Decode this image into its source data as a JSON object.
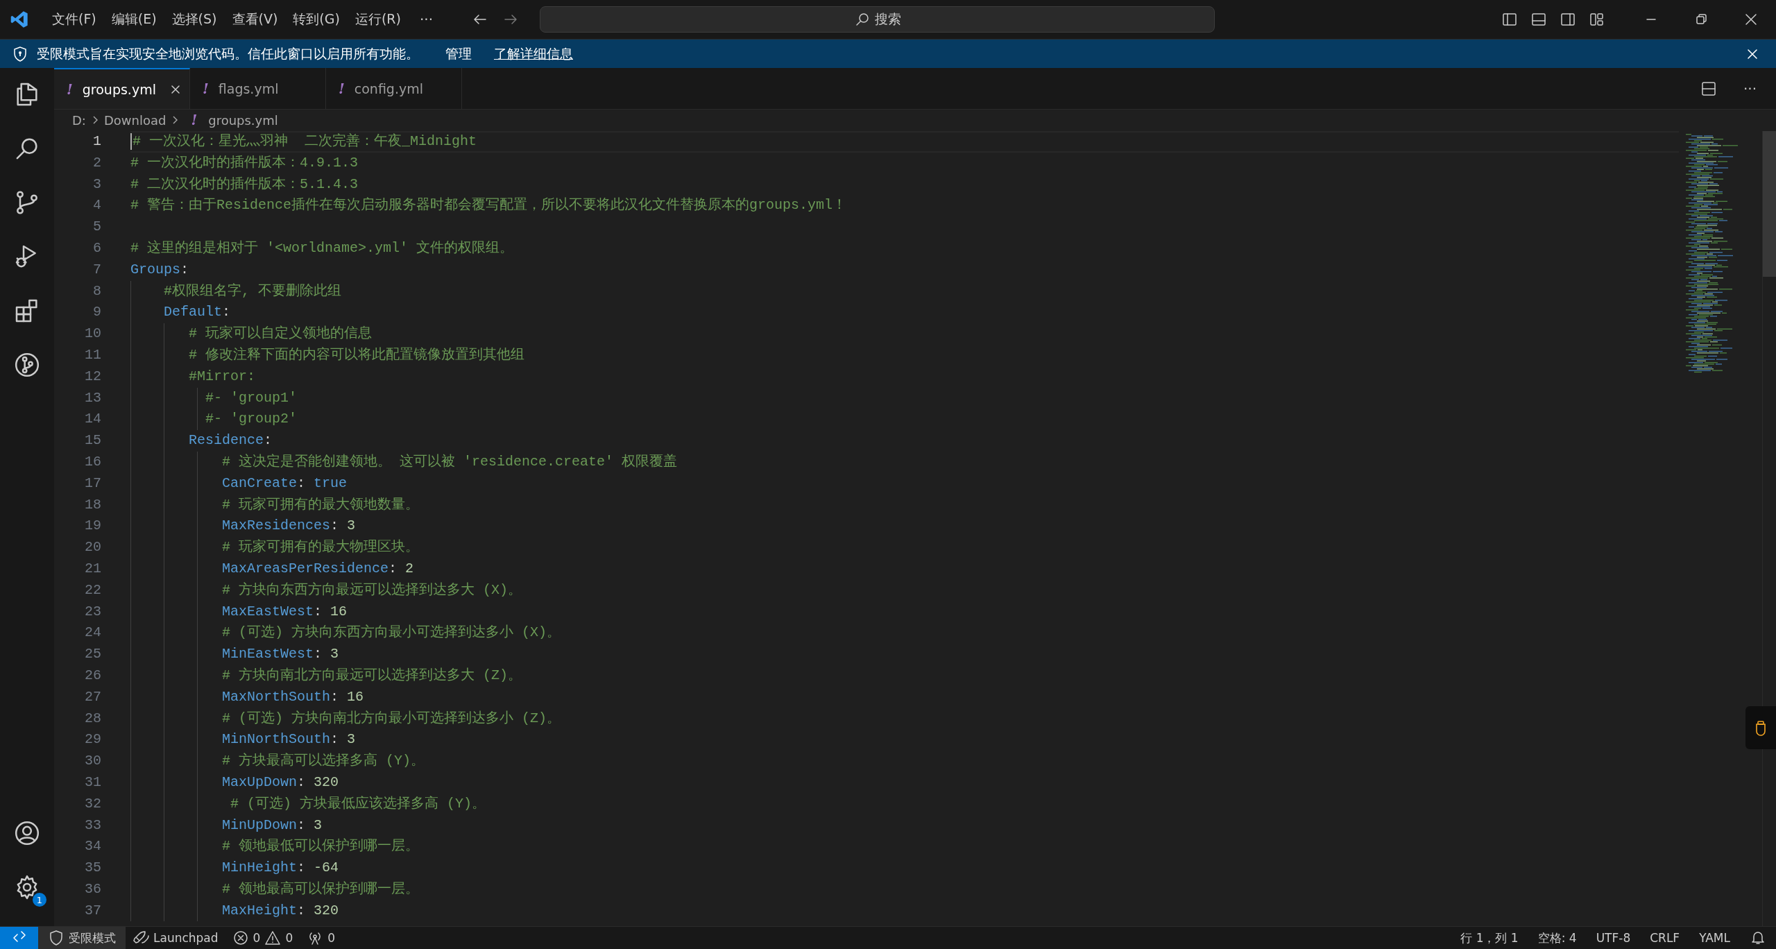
{
  "title_bar": {
    "menus": [
      "文件(F)",
      "编辑(E)",
      "选择(S)",
      "查看(V)",
      "转到(G)",
      "运行(R)"
    ],
    "more": "···",
    "search_label": "搜索"
  },
  "banner": {
    "message": "受限模式旨在实现安全地浏览代码。信任此窗口以启用所有功能。",
    "links": [
      "管理",
      "了解详细信息"
    ]
  },
  "tabs": [
    {
      "icon": "!",
      "label": "groups.yml",
      "selected": true
    },
    {
      "icon": "!",
      "label": "flags.yml",
      "selected": false
    },
    {
      "icon": "!",
      "label": "config.yml",
      "selected": false
    }
  ],
  "editor_more": "···",
  "breadcrumb": [
    {
      "label": "D:"
    },
    {
      "label": "Download"
    },
    {
      "icon": "!",
      "label": "groups.yml"
    }
  ],
  "lines": [
    {
      "number": "1",
      "active": true,
      "tokens": [
        {
          "kind": "comment",
          "text": "# 一次汉化：星光灬羽神  二次完善：午夜_Midnight"
        }
      ]
    },
    {
      "number": "2",
      "active": false,
      "tokens": [
        {
          "kind": "comment",
          "text": "# 一次汉化时的插件版本：4.9.1.3"
        }
      ]
    },
    {
      "number": "3",
      "active": false,
      "tokens": [
        {
          "kind": "comment",
          "text": "# 二次汉化时的插件版本：5.1.4.3"
        }
      ]
    },
    {
      "number": "4",
      "active": false,
      "tokens": [
        {
          "kind": "comment",
          "text": "# 警告：由于Residence插件在每次启动服务器时都会覆写配置，所以不要将此汉化文件替换原本的groups.yml！"
        }
      ]
    },
    {
      "number": "5",
      "active": false
    },
    {
      "number": "6",
      "active": false,
      "tokens": [
        {
          "kind": "comment",
          "text": "# 这里的组是相对于 '<worldname>.yml' 文件的权限组。"
        }
      ]
    },
    {
      "number": "7",
      "active": false,
      "tokens": [
        {
          "kind": "key",
          "text": "Groups"
        },
        {
          "kind": "punct",
          "text": ":"
        }
      ]
    },
    {
      "number": "8",
      "active": false,
      "tokens": [
        {
          "kind": "comment",
          "text": "    #权限组名字, 不要删除此组"
        }
      ]
    },
    {
      "number": "9",
      "active": false,
      "tokens": [
        {
          "kind": "key",
          "text": "    Default"
        },
        {
          "kind": "punct",
          "text": ":"
        }
      ]
    },
    {
      "number": "10",
      "active": false,
      "tokens": [
        {
          "kind": "comment",
          "text": "       # 玩家可以自定义领地的信息"
        }
      ]
    },
    {
      "number": "11",
      "active": false,
      "tokens": [
        {
          "kind": "comment",
          "text": "       # 修改注释下面的内容可以将此配置镜像放置到其他组"
        }
      ]
    },
    {
      "number": "12",
      "active": false,
      "tokens": [
        {
          "kind": "comment",
          "text": "       #Mirror:"
        }
      ]
    },
    {
      "number": "13",
      "active": false,
      "tokens": [
        {
          "kind": "comment",
          "text": "         #- 'group1'"
        }
      ]
    },
    {
      "number": "14",
      "active": false,
      "tokens": [
        {
          "kind": "comment",
          "text": "         #- 'group2'"
        }
      ]
    },
    {
      "number": "15",
      "active": false,
      "tokens": [
        {
          "kind": "key",
          "text": "       Residence"
        },
        {
          "kind": "punct",
          "text": ":"
        }
      ]
    },
    {
      "number": "16",
      "active": false,
      "tokens": [
        {
          "kind": "comment",
          "text": "           # 这决定是否能创建领地。 这可以被 'residence.create' 权限覆盖"
        }
      ]
    },
    {
      "number": "17",
      "active": false,
      "tokens": [
        {
          "kind": "key",
          "text": "           CanCreate"
        },
        {
          "kind": "punct",
          "text": ":"
        },
        {
          "kind": "bool",
          "text": "true"
        }
      ]
    },
    {
      "number": "18",
      "active": false,
      "tokens": [
        {
          "kind": "comment",
          "text": "           # 玩家可拥有的最大领地数量。"
        }
      ]
    },
    {
      "number": "19",
      "active": false,
      "tokens": [
        {
          "kind": "key",
          "text": "           MaxResidences"
        },
        {
          "kind": "punct",
          "text": ":"
        },
        {
          "kind": "number",
          "text": "3"
        }
      ]
    },
    {
      "number": "20",
      "active": false,
      "tokens": [
        {
          "kind": "comment",
          "text": "           # 玩家可拥有的最大物理区块。"
        }
      ]
    },
    {
      "number": "21",
      "active": false,
      "tokens": [
        {
          "kind": "key",
          "text": "           MaxAreasPerResidence"
        },
        {
          "kind": "punct",
          "text": ":"
        },
        {
          "kind": "number",
          "text": "2"
        }
      ]
    },
    {
      "number": "22",
      "active": false,
      "tokens": [
        {
          "kind": "comment",
          "text": "           # 方块向东西方向最远可以选择到达多大 (X)。"
        }
      ]
    },
    {
      "number": "23",
      "active": false,
      "tokens": [
        {
          "kind": "key",
          "text": "           MaxEastWest"
        },
        {
          "kind": "punct",
          "text": ":"
        },
        {
          "kind": "number",
          "text": "16"
        }
      ]
    },
    {
      "number": "24",
      "active": false,
      "tokens": [
        {
          "kind": "comment",
          "text": "           # (可选) 方块向东西方向最小可选择到达多小 (X)。"
        }
      ]
    },
    {
      "number": "25",
      "active": false,
      "tokens": [
        {
          "kind": "key",
          "text": "           MinEastWest"
        },
        {
          "kind": "punct",
          "text": ":"
        },
        {
          "kind": "number",
          "text": "3"
        }
      ]
    },
    {
      "number": "26",
      "active": false,
      "tokens": [
        {
          "kind": "comment",
          "text": "           # 方块向南北方向最远可以选择到达多大 (Z)。"
        }
      ]
    },
    {
      "number": "27",
      "active": false,
      "tokens": [
        {
          "kind": "key",
          "text": "           MaxNorthSouth"
        },
        {
          "kind": "punct",
          "text": ":"
        },
        {
          "kind": "number",
          "text": "16"
        }
      ]
    },
    {
      "number": "28",
      "active": false,
      "tokens": [
        {
          "kind": "comment",
          "text": "           # (可选) 方块向南北方向最小可选择到达多小 (Z)。"
        }
      ]
    },
    {
      "number": "29",
      "active": false,
      "tokens": [
        {
          "kind": "key",
          "text": "           MinNorthSouth"
        },
        {
          "kind": "punct",
          "text": ":"
        },
        {
          "kind": "number",
          "text": "3"
        }
      ]
    },
    {
      "number": "30",
      "active": false,
      "tokens": [
        {
          "kind": "comment",
          "text": "           # 方块最高可以选择多高 (Y)。"
        }
      ]
    },
    {
      "number": "31",
      "active": false,
      "tokens": [
        {
          "kind": "key",
          "text": "           MaxUpDown"
        },
        {
          "kind": "punct",
          "text": ":"
        },
        {
          "kind": "number",
          "text": "320"
        }
      ]
    },
    {
      "number": "32",
      "active": false,
      "tokens": [
        {
          "kind": "comment",
          "text": "            # (可选) 方块最低应该选择多高 (Y)。"
        }
      ]
    },
    {
      "number": "33",
      "active": false,
      "tokens": [
        {
          "kind": "key",
          "text": "           MinUpDown"
        },
        {
          "kind": "punct",
          "text": ":"
        },
        {
          "kind": "number",
          "text": "3"
        }
      ]
    },
    {
      "number": "34",
      "active": false,
      "tokens": [
        {
          "kind": "comment",
          "text": "           # 领地最低可以保护到哪一层。"
        }
      ]
    },
    {
      "number": "35",
      "active": false,
      "tokens": [
        {
          "kind": "key",
          "text": "           MinHeight"
        },
        {
          "kind": "punct",
          "text": ":"
        },
        {
          "kind": "number",
          "text": "-64"
        }
      ]
    },
    {
      "number": "36",
      "active": false,
      "tokens": [
        {
          "kind": "comment",
          "text": "           # 领地最高可以保护到哪一层。"
        }
      ]
    },
    {
      "number": "37",
      "active": false,
      "tokens": [
        {
          "kind": "key",
          "text": "           MaxHeight"
        },
        {
          "kind": "punct",
          "text": ":"
        },
        {
          "kind": "number",
          "text": "320"
        }
      ]
    }
  ],
  "activity_badge": "1",
  "status_bar": {
    "restricted": "受限模式",
    "launchpad": "Launchpad",
    "errors": "0",
    "warnings": "0",
    "ports": "0",
    "position": "行 1，列 1",
    "indentation": "空格: 4",
    "encoding": "UTF-8",
    "eol": "CRLF",
    "language": "YAML"
  }
}
